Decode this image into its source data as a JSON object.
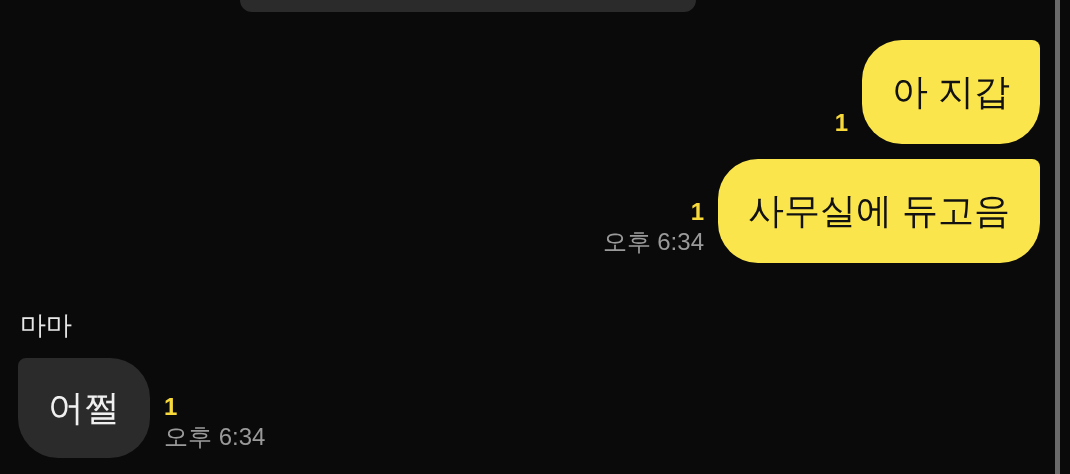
{
  "messages": [
    {
      "kind": "outgoing",
      "text": "아 지갑",
      "unread": "1"
    },
    {
      "kind": "outgoing",
      "text": "사무실에 듀고음",
      "unread": "1",
      "time": "오후 6:34"
    },
    {
      "kind": "incoming",
      "sender": "마마",
      "text": "어쩔",
      "unread": "1",
      "time": "오후 6:34"
    }
  ]
}
